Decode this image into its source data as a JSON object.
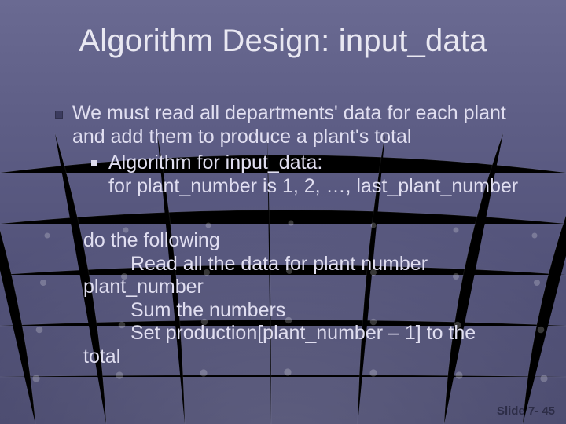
{
  "title": "Algorithm Design: input_data",
  "body": {
    "lead": "We must read all departments' data for each plant and add them to produce a plant's total",
    "sub_label": "Algorithm for input_data:",
    "sub_line2": "for plant_number is 1, 2, …, last_plant_number",
    "block": {
      "l1": "do the following",
      "l2": "Read all the data for plant number",
      "l3": "plant_number",
      "l4": "Sum the numbers",
      "l5": "Set production[plant_number – 1] to the",
      "l6": "total"
    }
  },
  "footer": {
    "label": "Slide 7-",
    "num": "45"
  }
}
